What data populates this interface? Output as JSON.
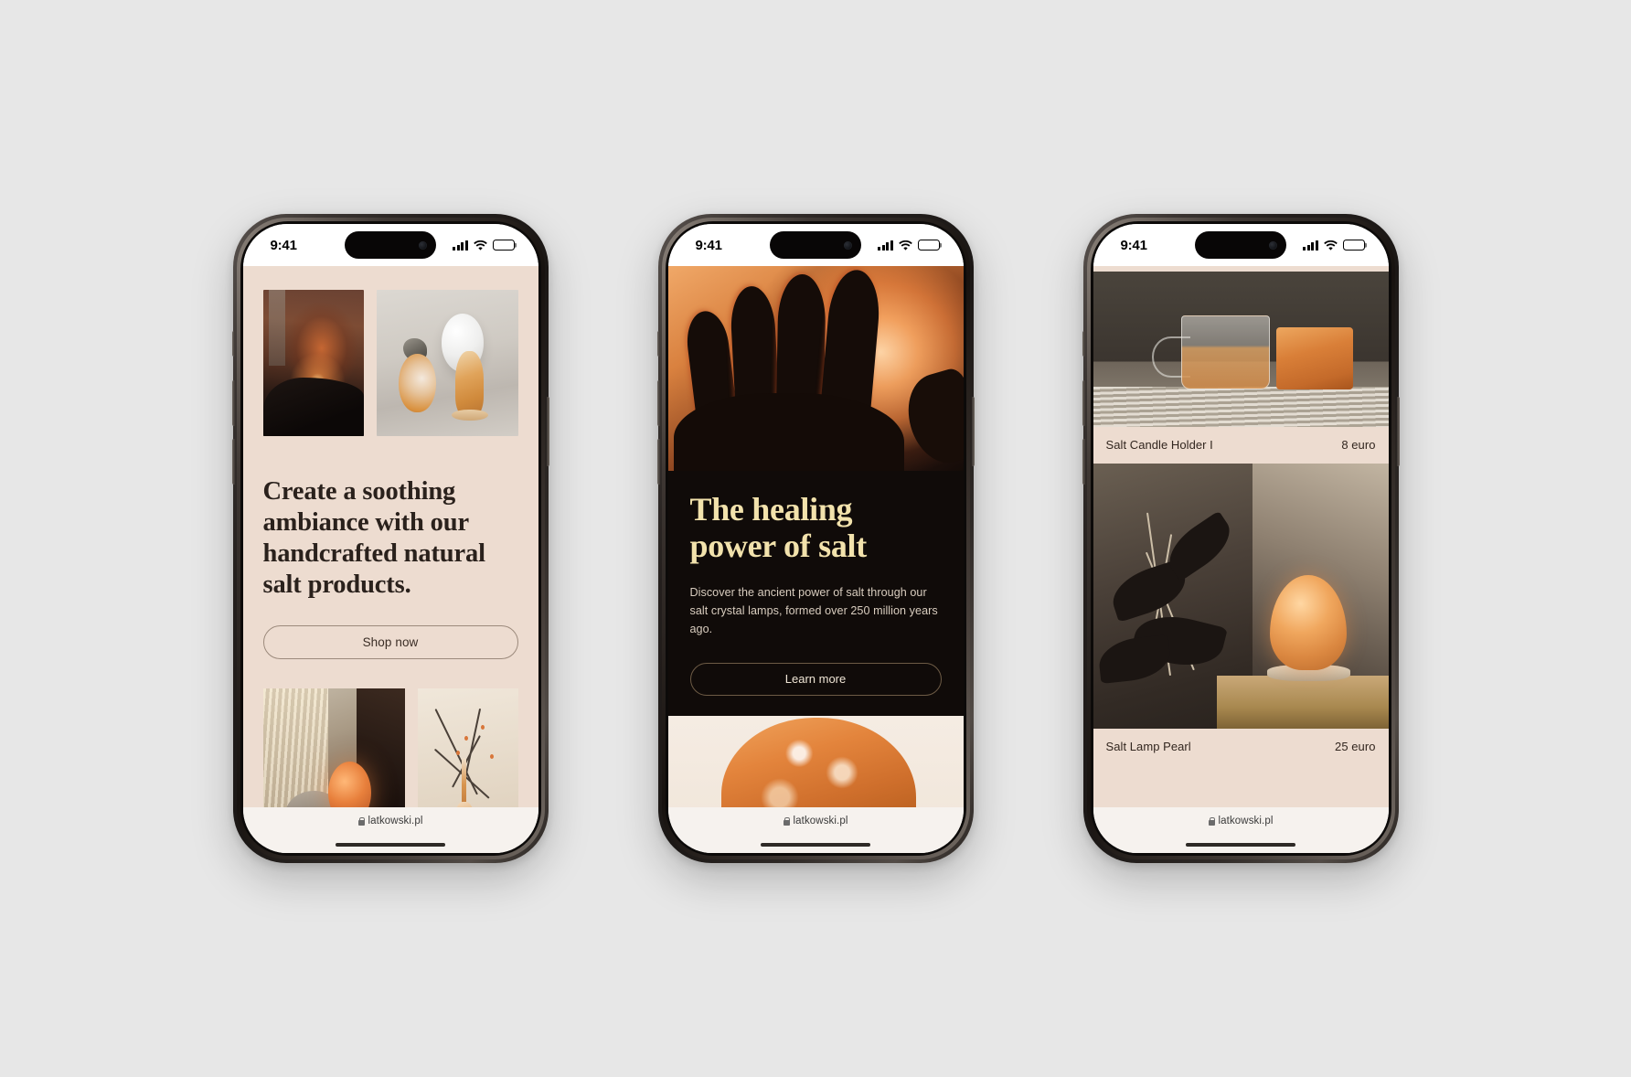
{
  "background_color": "#e7e7e7",
  "status_bar": {
    "time": "9:41",
    "signal_icon": "cellular-bars-icon",
    "wifi_icon": "wifi-icon",
    "battery_icon": "battery-icon",
    "battery_level_pct": 58,
    "dynamic_island": "dynamic-island"
  },
  "browser_bar": {
    "lock_icon": "lock-icon",
    "url": "latkowski.pl",
    "home_indicator": "home-indicator"
  },
  "colors": {
    "cream": "#eddcd0",
    "dark": "#100b09",
    "heading_dark": "#2a211c",
    "heading_cream": "#f2e2ac",
    "accent_orange": "#d9813f"
  },
  "phones": [
    {
      "id": "phone-1",
      "screen_name": "home-hero",
      "headline": "Create a soothing ambiance with our handcrafted natural salt products.",
      "cta_label": "Shop now",
      "images": [
        {
          "name": "image-lamp-dark-room",
          "alt": "Salt lamp glowing in a dark room"
        },
        {
          "name": "image-salt-orbs",
          "alt": "Salt orbs and crystal sphere on light surface"
        },
        {
          "name": "image-window-curtain",
          "alt": "Orange salt lamp by a curtained window"
        },
        {
          "name": "image-branches-holders",
          "alt": "Dried branches with salt candle holders"
        }
      ]
    },
    {
      "id": "phone-2",
      "screen_name": "healing-article",
      "headline": "The healing power of salt",
      "body": "Discover the ancient power of salt through our salt crystal lamps, formed over 250 million years ago.",
      "cta_label": "Learn more",
      "images": [
        {
          "name": "image-hand-silhouette",
          "alt": "Silhouetted hand touching a glowing salt lamp"
        },
        {
          "name": "image-salt-crystal",
          "alt": "Orange salt crystal rock on cream background"
        }
      ]
    },
    {
      "id": "phone-3",
      "screen_name": "product-list",
      "products": [
        {
          "name": "Salt Candle Holder I",
          "price": "8 euro",
          "image": {
            "name": "image-mug-candle",
            "alt": "Glass mug and salt candle holder on striped cloth"
          }
        },
        {
          "name": "Salt Lamp Pearl",
          "price": "25 euro",
          "image": {
            "name": "image-plant-lamp",
            "alt": "Salt lamp on a wooden dresser beside a plant"
          }
        }
      ]
    }
  ]
}
